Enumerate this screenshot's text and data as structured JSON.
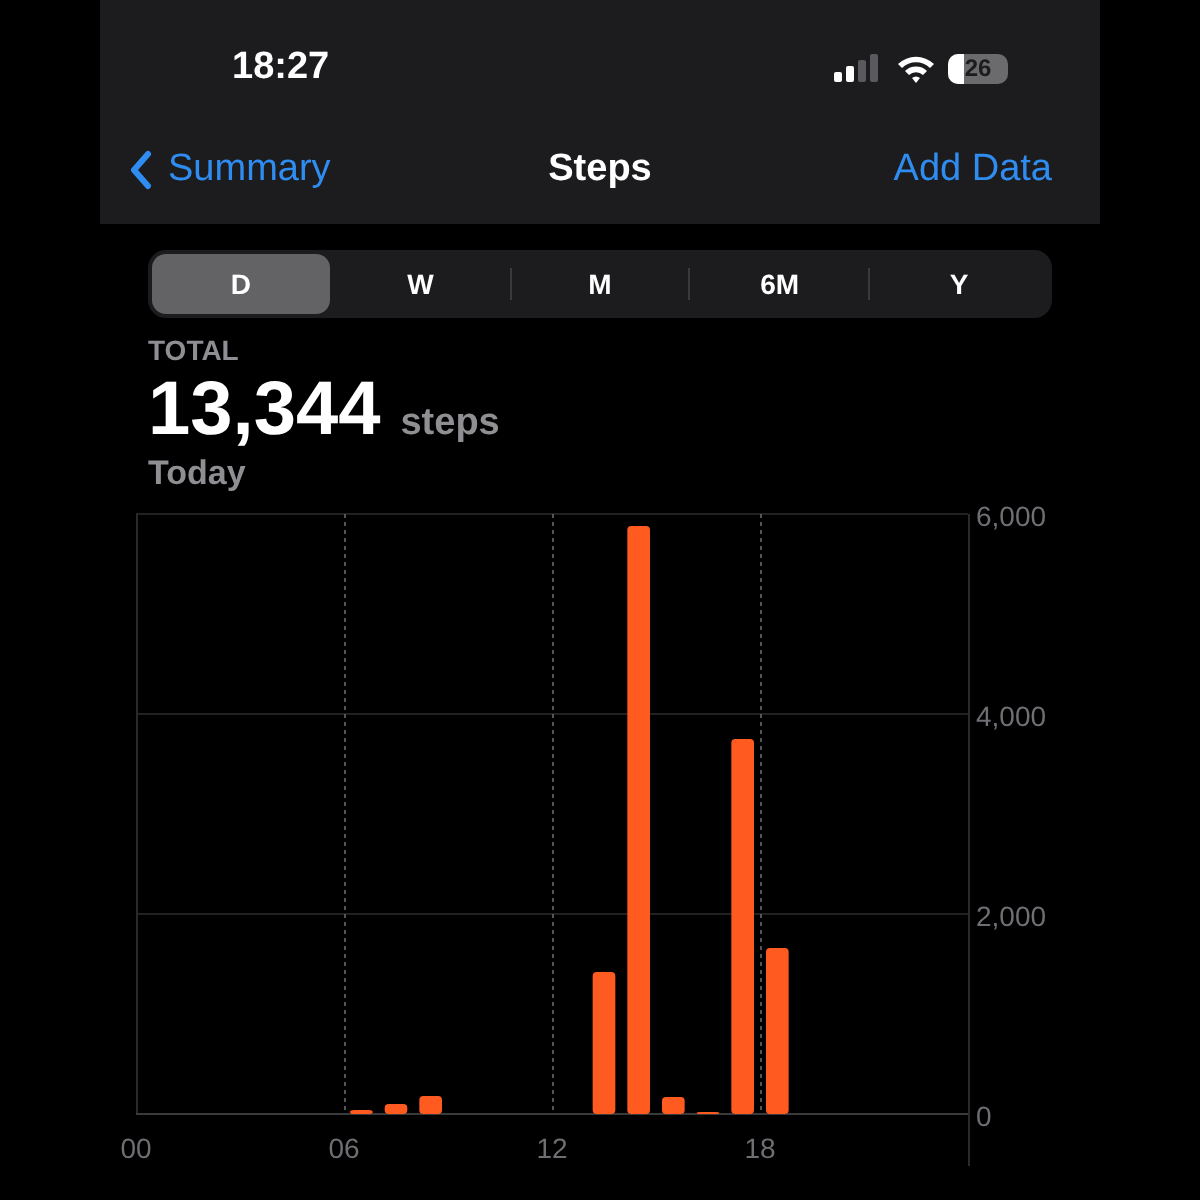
{
  "status_bar": {
    "time": "18:27",
    "battery": "26"
  },
  "nav": {
    "back": "Summary",
    "title": "Steps",
    "action": "Add Data"
  },
  "tabs": [
    {
      "label": "D",
      "selected": true
    },
    {
      "label": "W",
      "selected": false
    },
    {
      "label": "M",
      "selected": false
    },
    {
      "label": "6M",
      "selected": false
    },
    {
      "label": "Y",
      "selected": false
    }
  ],
  "summary": {
    "label": "TOTAL",
    "value": "13,344",
    "unit": "steps",
    "period": "Today"
  },
  "chart": {
    "chart_data": {
      "type": "bar",
      "x": [
        0.5,
        1.5,
        2.5,
        3.5,
        4.5,
        5.5,
        6.5,
        7.5,
        8.5,
        9.5,
        10.5,
        11.5,
        12.5,
        13.5,
        14.5,
        15.5,
        16.5,
        17.5,
        18.5,
        19.5,
        20.5,
        21.5,
        22.5,
        23.5
      ],
      "xlim": [
        0,
        24
      ],
      "series": [
        {
          "color": "#ff5a1f",
          "values": [
            0,
            0,
            0,
            0,
            0,
            0,
            40,
            100,
            180,
            0,
            0,
            0,
            0,
            1420,
            5880,
            170,
            20,
            3750,
            1660,
            0,
            0,
            0,
            0,
            0
          ]
        }
      ],
      "ylim": [
        0,
        6000
      ],
      "grid": true,
      "yticks": [
        0,
        {
          "value": 2000,
          "label": "2,000"
        },
        {
          "value": 4000,
          "label": "4,000"
        },
        {
          "value": 6000,
          "label": "6,000"
        }
      ],
      "xticks": [
        {
          "value": 0,
          "label": "00"
        },
        {
          "value": 6,
          "label": "06"
        },
        {
          "value": 12,
          "label": "12"
        },
        {
          "value": 18,
          "label": "18"
        }
      ]
    }
  }
}
